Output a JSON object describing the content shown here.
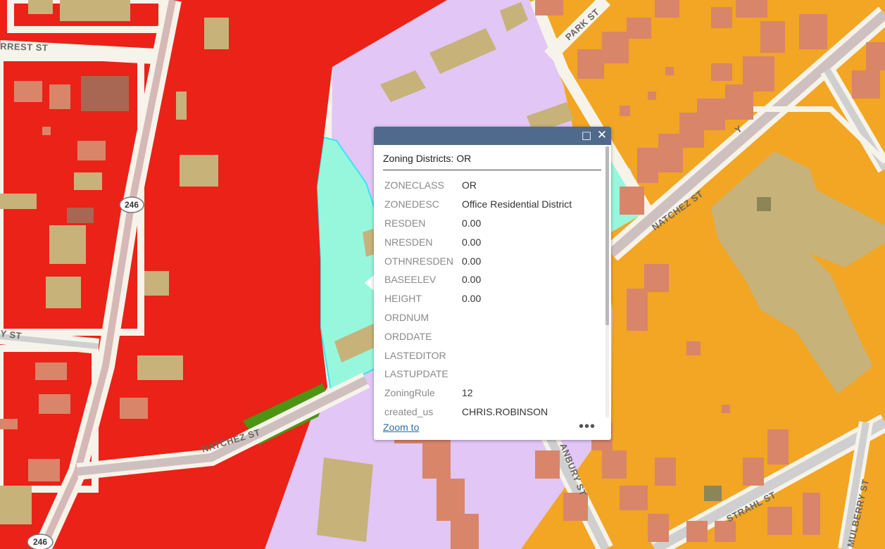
{
  "map": {
    "streets": {
      "forrest": "RREST ST",
      "park": "PARK ST",
      "natchez_west": "NATCHEZ ST",
      "natchez_east": "NATCHEZ ST",
      "y_st": "Y ST",
      "strahl": "STRAHL ST",
      "mulberry": "MULBERRY ST",
      "anbury": "ANBURY ST",
      "y_label": "Y"
    },
    "route_shields": [
      "246",
      "246"
    ],
    "colors": {
      "commercial_red": "#ea2218",
      "residential_orange": "#f2a623",
      "office_residential_lilac": "#e1c6f6",
      "selected_cyan": "#97f7dd",
      "green_zone": "#4e9413",
      "building": "#c7b27a",
      "building_brick": "#d9856a"
    }
  },
  "popup": {
    "title": "Zoning Districts: OR",
    "maximize_icon": "□",
    "close_icon": "✕",
    "fields": [
      {
        "key": "ZONECLASS",
        "value": "OR"
      },
      {
        "key": "ZONEDESC",
        "value": "Office Residential District"
      },
      {
        "key": "RESDEN",
        "value": "0.00"
      },
      {
        "key": "NRESDEN",
        "value": "0.00"
      },
      {
        "key": "OTHNRESDEN",
        "value": "0.00"
      },
      {
        "key": "BASEELEV",
        "value": "0.00"
      },
      {
        "key": "HEIGHT",
        "value": "0.00"
      },
      {
        "key": "ORDNUM",
        "value": ""
      },
      {
        "key": "ORDDATE",
        "value": ""
      },
      {
        "key": "LASTEDITOR",
        "value": ""
      },
      {
        "key": "LASTUPDATE",
        "value": ""
      },
      {
        "key": "ZoningRule",
        "value": "12"
      },
      {
        "key": "created_us",
        "value": "CHRIS.ROBINSON"
      }
    ],
    "zoom_label": "Zoom to",
    "more_label": "•••"
  }
}
